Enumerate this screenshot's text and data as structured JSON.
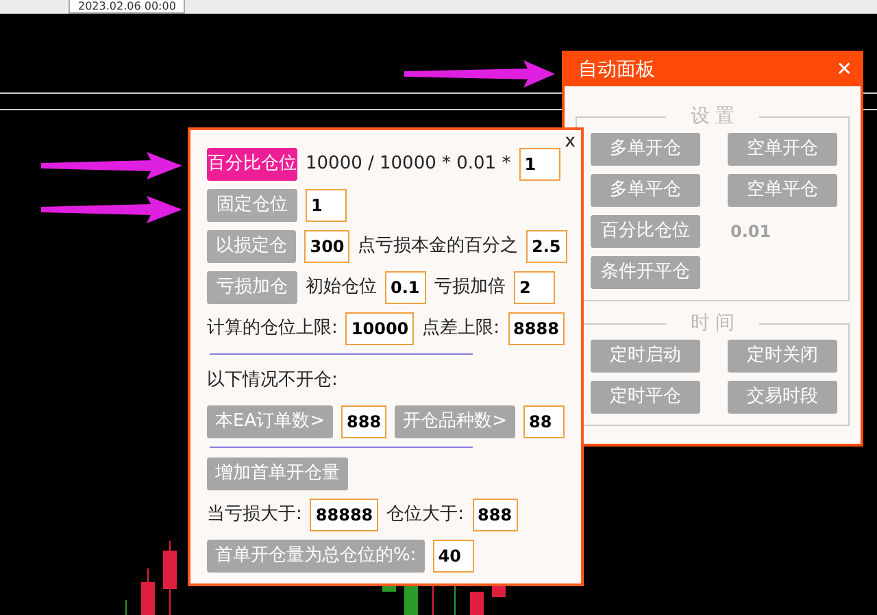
{
  "toolbar": {
    "date_value": "2023.02.06 00:00"
  },
  "auto_panel": {
    "title": "自动面板",
    "close": "✕",
    "sections": [
      {
        "legend": "设 置",
        "items": [
          {
            "kind": "button",
            "label": "多单开仓"
          },
          {
            "kind": "button",
            "label": "空单开仓"
          },
          {
            "kind": "button",
            "label": "多单平仓"
          },
          {
            "kind": "button",
            "label": "空单平仓"
          },
          {
            "kind": "button",
            "label": "百分比仓位"
          },
          {
            "kind": "value",
            "label": "0.01"
          },
          {
            "kind": "button",
            "label": "条件开平仓"
          }
        ]
      },
      {
        "legend": "时 间",
        "items": [
          {
            "kind": "button",
            "label": "定时启动"
          },
          {
            "kind": "button",
            "label": "定时关闭"
          },
          {
            "kind": "button",
            "label": "定时平仓"
          },
          {
            "kind": "button",
            "label": "交易时段"
          }
        ]
      }
    ]
  },
  "settings_panel": {
    "close": "x",
    "rows": [
      {
        "kind": "row",
        "parts": [
          {
            "kind": "mode",
            "label": "百分比仓位",
            "selected": true
          },
          {
            "kind": "text",
            "label": "10000 / 10000 * 0.01 *"
          },
          {
            "kind": "input",
            "value": "1"
          }
        ]
      },
      {
        "kind": "row",
        "parts": [
          {
            "kind": "mode",
            "label": "固定仓位",
            "selected": false
          },
          {
            "kind": "input",
            "value": "1"
          }
        ]
      },
      {
        "kind": "row",
        "parts": [
          {
            "kind": "mode",
            "label": "以损定仓",
            "selected": false
          },
          {
            "kind": "input",
            "value": "300"
          },
          {
            "kind": "text",
            "label": "点亏损本金的百分之"
          },
          {
            "kind": "input",
            "value": "2.5"
          }
        ]
      },
      {
        "kind": "row",
        "parts": [
          {
            "kind": "mode",
            "label": "亏损加仓",
            "selected": false
          },
          {
            "kind": "text",
            "label": "初始仓位"
          },
          {
            "kind": "input",
            "value": "0.1"
          },
          {
            "kind": "text",
            "label": "亏损加倍"
          },
          {
            "kind": "input",
            "value": "2"
          }
        ]
      },
      {
        "kind": "row",
        "parts": [
          {
            "kind": "text",
            "label": "计算的仓位上限:"
          },
          {
            "kind": "input",
            "value": "10000"
          },
          {
            "kind": "text",
            "label": "点差上限:"
          },
          {
            "kind": "input",
            "value": "8888"
          }
        ]
      },
      {
        "kind": "divider"
      },
      {
        "kind": "row",
        "parts": [
          {
            "kind": "text",
            "label": "以下情况不开仓:"
          }
        ]
      },
      {
        "kind": "row",
        "parts": [
          {
            "kind": "button",
            "label": "本EA订单数>"
          },
          {
            "kind": "input",
            "value": "888"
          },
          {
            "kind": "button",
            "label": "开仓品种数>"
          },
          {
            "kind": "input",
            "value": "88"
          }
        ]
      },
      {
        "kind": "divider"
      },
      {
        "kind": "row",
        "parts": [
          {
            "kind": "button",
            "label": "增加首单开仓量"
          }
        ]
      },
      {
        "kind": "row",
        "parts": [
          {
            "kind": "text",
            "label": "当亏损大于:"
          },
          {
            "kind": "input",
            "value": "88888"
          },
          {
            "kind": "text",
            "label": "仓位大于:"
          },
          {
            "kind": "input",
            "value": "888"
          }
        ]
      },
      {
        "kind": "row",
        "parts": [
          {
            "kind": "button",
            "label": "首单开仓量为总仓位的%:"
          },
          {
            "kind": "input",
            "value": "40"
          }
        ]
      }
    ]
  }
}
